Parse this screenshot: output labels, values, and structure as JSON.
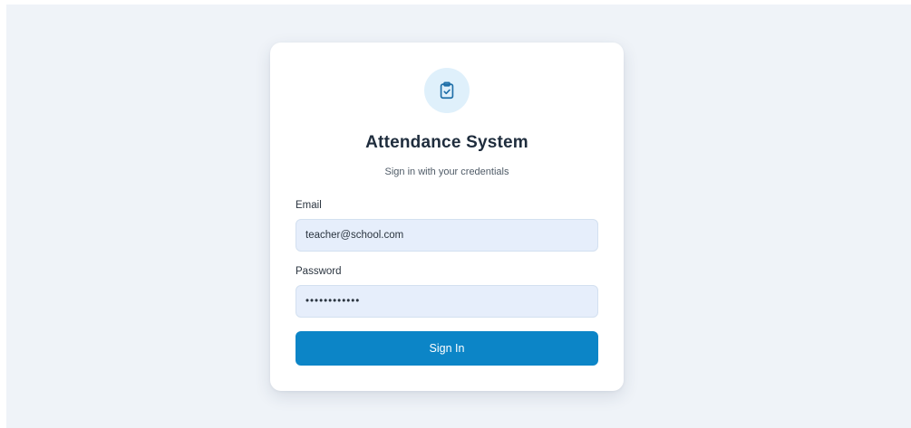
{
  "login": {
    "icon": "clipboard-check-icon",
    "title": "Attendance System",
    "subtitle": "Sign in with your credentials",
    "email": {
      "label": "Email",
      "value": "teacher@school.com"
    },
    "password": {
      "label": "Password",
      "value": "••••••••••••"
    },
    "submit_label": "Sign In"
  },
  "colors": {
    "page_background": "#eff3f8",
    "card_background": "#ffffff",
    "accent": "#0c85c7",
    "icon_circle": "#dff0fb",
    "input_background": "#e6eefb",
    "title_text": "#1f2d3d"
  }
}
